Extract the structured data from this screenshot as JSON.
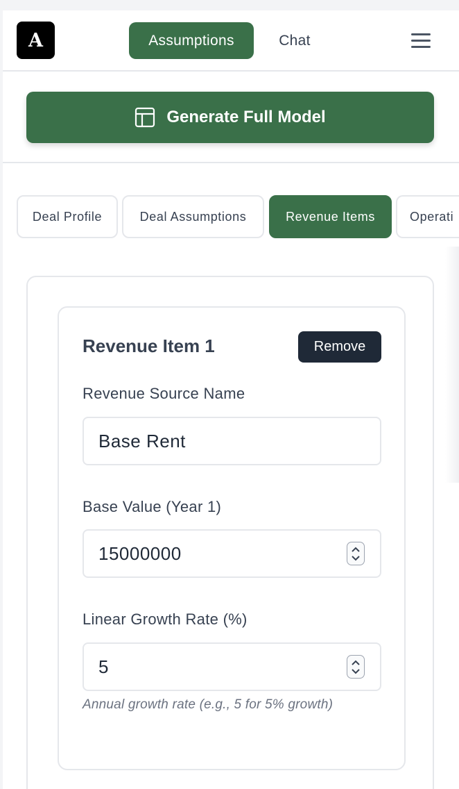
{
  "header": {
    "logo_letter": "A",
    "tabs": [
      {
        "label": "Assumptions",
        "active": true
      },
      {
        "label": "Chat",
        "active": false
      }
    ],
    "menu_icon": "hamburger-icon"
  },
  "actions": {
    "generate_label": "Generate Full Model",
    "generate_icon": "layout-icon"
  },
  "section_tabs": [
    {
      "label": "Deal Profile",
      "active": false
    },
    {
      "label": "Deal Assumptions",
      "active": false
    },
    {
      "label": "Revenue Items",
      "active": true
    },
    {
      "label": "Operati",
      "active": false
    }
  ],
  "revenue_item": {
    "title": "Revenue Item 1",
    "remove_label": "Remove",
    "fields": {
      "name_label": "Revenue Source Name",
      "name_value": "Base Rent",
      "base_label": "Base Value (Year 1)",
      "base_value": "15000000",
      "growth_label": "Linear Growth Rate (%)",
      "growth_value": "5",
      "growth_hint": "Annual growth rate (e.g., 5 for 5% growth)"
    }
  },
  "colors": {
    "brand_green": "#3a7049",
    "dark_button": "#1f2937",
    "border": "#e5e7eb"
  }
}
